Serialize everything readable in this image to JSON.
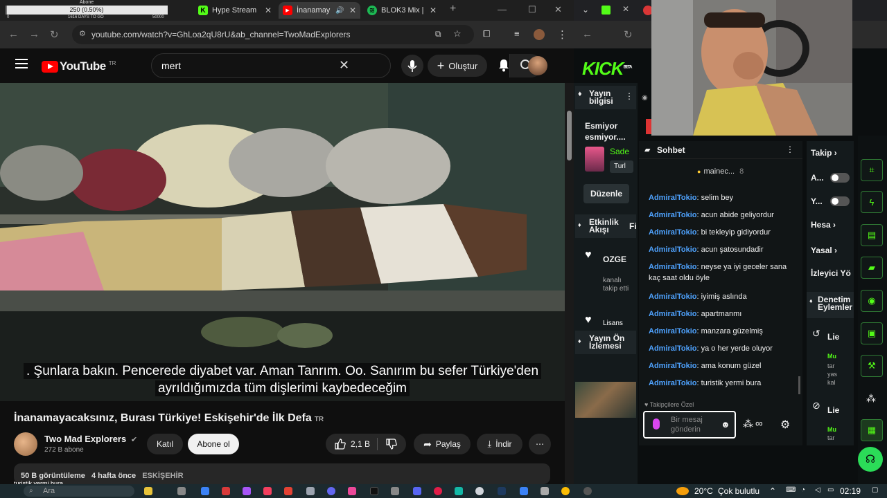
{
  "obs_widget": {
    "label": "Abone",
    "value": "250 (0.50%)",
    "progress_fraction": 0.005,
    "left_label": "0",
    "mid_label": "1616 DAYS TO GO",
    "right_label": "50000"
  },
  "left_tabs": [
    {
      "label": "Hype Stream",
      "favicon": "kick"
    },
    {
      "label": "İnanamay",
      "favicon": "youtube"
    },
    {
      "label": "BLOK3 Mix | ",
      "favicon": "spotify"
    }
  ],
  "left_url": "youtube.com/watch?v=GhLoa2qU8rU&ab_channel=TwoMadExplorers",
  "youtube": {
    "logo_text": "YouTube",
    "country_code": "TR",
    "search_value": "mert",
    "create_label": "Oluştur"
  },
  "video": {
    "caption_line1": ". Şunlara bakın. Pencerede diyabet var. Aman Tanrım. Oo. Sanırım bu sefer Türkiye'den",
    "caption_line2": "ayrıldığımızda tüm dişlerimi kaybedeceğim",
    "title": "İnanamayacaksınız, Burası Türkiye! Eskişehir'de İlk Defa",
    "title_badge": "TR",
    "channel_name": "Two Mad Explorers",
    "subscribers": "272 B abone",
    "join_label": "Katıl",
    "subscribe_label": "Abone ol",
    "likes": "2,1 B",
    "share_label": "Paylaş",
    "download_label": "İndir",
    "views": "50 B görüntüleme",
    "age": "4 hafta önce",
    "location": "ESKİŞEHİR"
  },
  "overlay_chat_line": "turistik yermi bura",
  "kick": {
    "logo": "KICK",
    "logo_sup": "BETA",
    "left_panel": {
      "stream_info_label": "Yayın bilgisi",
      "stream_title": "Esmiyor esmiyor....",
      "featured_name": "Sade",
      "featured_tag": "Turl",
      "edit_label": "Düzenle",
      "activity_label": "Etkinlik Akışı",
      "activity_extra": "Fi",
      "follow_user": "OZGE",
      "follow_text": "kanalı takip etti",
      "more_text": "Lisans",
      "preview_label": "Yayın Ön İzlemesi"
    },
    "chat": {
      "title": "Sohbet",
      "pinned_user": "mainec...",
      "pinned_count": "8",
      "messages": [
        {
          "user": "AdmiralTokio",
          "text": "selim bey"
        },
        {
          "user": "AdmiralTokio",
          "text": "acun abide geliyordur"
        },
        {
          "user": "AdmiralTokio",
          "text": "bi tekleyip gidiyordur"
        },
        {
          "user": "AdmiralTokio",
          "text": "acun şatosundadir"
        },
        {
          "user": "AdmiralTokio",
          "text": "neyse ya iyi geceler sana kaç saat oldu öyle"
        },
        {
          "user": "AdmiralTokio",
          "text": "iyimiş aslında"
        },
        {
          "user": "AdmiralTokio",
          "text": "apartmanmı"
        },
        {
          "user": "AdmiralTokio",
          "text": "manzara güzelmiş"
        },
        {
          "user": "AdmiralTokio",
          "text": "ya o her yerde oluyor"
        },
        {
          "user": "AdmiralTokio",
          "text": "ama konum güzel"
        },
        {
          "user": "AdmiralTokio",
          "text": "turistik yermi bura"
        }
      ],
      "followers_only": "Takipçilere Özel",
      "input_placeholder": "Bir mesaj gönderin"
    },
    "settings": {
      "follow_label": "Takip",
      "a_label": "A...",
      "y_label": "Y...",
      "account_label": "Hesa",
      "legal_label": "Yasal",
      "viewers_label": "İzleyici Yö",
      "mod_actions_label": "Denetim Eylemler",
      "item1": "Lie",
      "item1_sub_a": "Mu",
      "item1_sub_b": "tar",
      "item1_sub_c": "yas",
      "item1_sub_d": "kal",
      "item2": "Lie",
      "item2_sub_a": "Mu",
      "item2_sub_b": "tar"
    }
  },
  "taskbar": {
    "search_label": "Ara",
    "weather": "20°C",
    "weather_desc": "Çok bulutlu",
    "time": "02:19"
  },
  "colors": {
    "youtube_red": "#ff0000",
    "kick_green": "#53fc18",
    "chat_user_blue": "#4fa3ff"
  }
}
